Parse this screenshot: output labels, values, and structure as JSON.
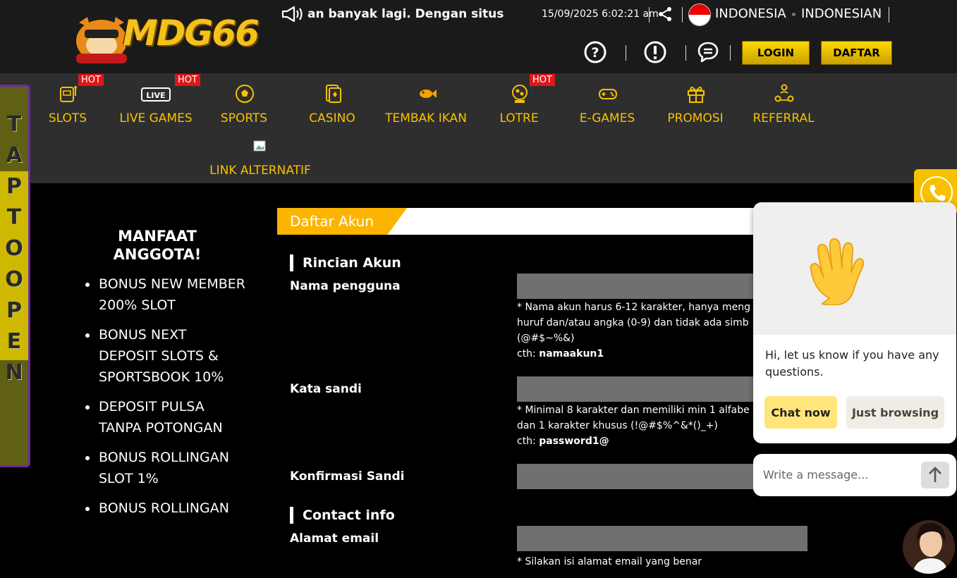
{
  "header": {
    "logo_text": "MDG66",
    "marquee_text": "an banyak lagi. Dengan situs",
    "datetime": "15/09/2025 6:02:21 am",
    "country": "INDONESIA",
    "language": "INDONESIAN",
    "icons": [
      "megaphone-icon",
      "share-icon",
      "help-icon",
      "info-icon",
      "chat-icon"
    ],
    "login_label": "LOGIN",
    "register_label": "DAFTAR"
  },
  "nav": {
    "hot_label": "HOT",
    "items": [
      {
        "label": "SLOTS",
        "icon": "slot-machine-icon",
        "hot": true
      },
      {
        "label": "LIVE GAMES",
        "icon": "live-tv-icon",
        "hot": true
      },
      {
        "label": "SPORTS",
        "icon": "soccer-ball-icon",
        "hot": false
      },
      {
        "label": "CASINO",
        "icon": "playing-cards-icon",
        "hot": false
      },
      {
        "label": "TEMBAK IKAN",
        "icon": "fish-icon",
        "hot": false
      },
      {
        "label": "LOTRE",
        "icon": "lottery-ball-icon",
        "hot": true
      },
      {
        "label": "E-GAMES",
        "icon": "gamepad-icon",
        "hot": false
      },
      {
        "label": "PROMOSI",
        "icon": "gift-icon",
        "hot": false
      },
      {
        "label": "REFERRAL",
        "icon": "referral-icon",
        "hot": false
      }
    ],
    "alt_link_label": "LINK ALTERNATIF"
  },
  "side_banner": {
    "letters": [
      "T",
      "A",
      "P",
      "T",
      "O",
      "O",
      "P",
      "E",
      "N"
    ]
  },
  "benefits": {
    "title_line1": "MANFAAT",
    "title_line2": "ANGGOTA!",
    "items": [
      "BONUS NEW MEMBER 200% SLOT",
      "BONUS NEXT DEPOSIT SLOTS & SPORTSBOOK 10%",
      "DEPOSIT PULSA TANPA POTONGAN",
      "BONUS ROLLINGAN SLOT 1%",
      "BONUS ROLLINGAN"
    ]
  },
  "form": {
    "tab_label": "Daftar Akun",
    "section_account": "Rincian Akun",
    "username_label": "Nama pengguna",
    "username_hint_1": "* Nama akun harus 6-12 karakter, hanya meng",
    "username_hint_2": "huruf dan/atau angka (0-9) dan tidak ada simb",
    "username_hint_3": "(@#$~%&)",
    "username_example_prefix": "cth: ",
    "username_example": "namaakun1",
    "password_label": "Kata sandi",
    "password_hint_1": "* Minimal 8 karakter dan memiliki min 1 alfabe",
    "password_hint_2": "dan 1 karakter khusus (!@#$%^&*()_+)",
    "password_example_prefix": "cth: ",
    "password_example": "password1@",
    "confirm_label": "Konfirmasi Sandi",
    "section_contact": "Contact info",
    "email_label": "Alamat email",
    "email_hint": "* Silakan isi alamat email yang benar"
  },
  "chat": {
    "message": "Hi, let us know if you have any questions.",
    "chat_now_label": "Chat now",
    "just_browsing_label": "Just browsing",
    "input_placeholder": "Write a message..."
  },
  "colors": {
    "accent_gold": "#f7c100",
    "hot_red": "#e0181a",
    "nav_bg": "#2e2e2e",
    "header_bg": "#1a1a1a"
  }
}
